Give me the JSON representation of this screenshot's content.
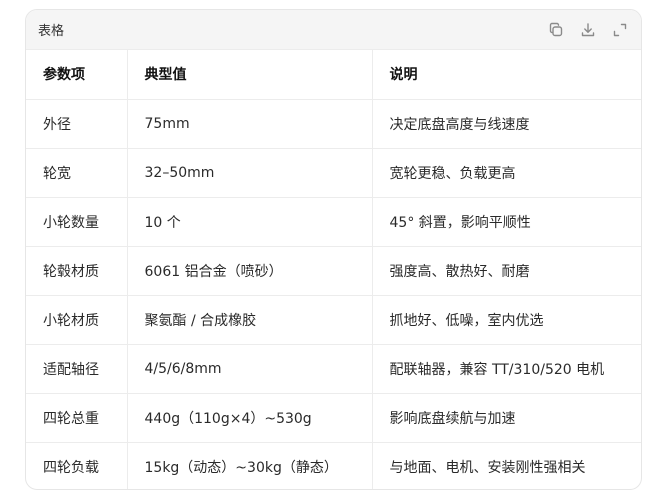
{
  "card": {
    "title": "表格",
    "tools": [
      {
        "icon": "copy-icon"
      },
      {
        "icon": "download-icon"
      },
      {
        "icon": "expand-icon"
      }
    ]
  },
  "table": {
    "headers": [
      "参数项",
      "典型值",
      "说明"
    ],
    "rows": [
      [
        "外径",
        "75mm",
        "决定底盘高度与线速度"
      ],
      [
        "轮宽",
        "32–50mm",
        "宽轮更稳、负载更高"
      ],
      [
        "小轮数量",
        "10 个",
        "45° 斜置，影响平顺性"
      ],
      [
        "轮毂材质",
        "6061 铝合金（喷砂）",
        "强度高、散热好、耐磨"
      ],
      [
        "小轮材质",
        "聚氨酯 / 合成橡胶",
        "抓地好、低噪，室内优选"
      ],
      [
        "适配轴径",
        "4/5/6/8mm",
        "配联轴器，兼容 TT/310/520 电机"
      ],
      [
        "四轮总重",
        "440g（110g×4）~530g",
        "影响底盘续航与加速"
      ],
      [
        "四轮负载",
        "15kg（动态）~30kg（静态）",
        "与地面、电机、安装刚性强相关"
      ]
    ]
  }
}
